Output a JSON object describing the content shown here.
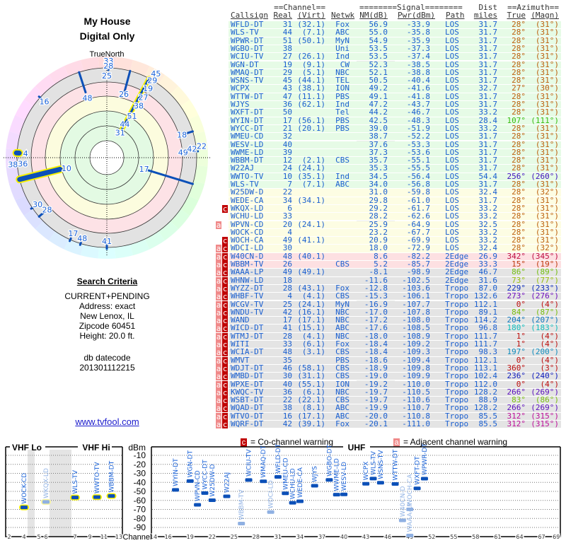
{
  "title": {
    "line1": "My House",
    "line2": "Digital Only"
  },
  "radar": {
    "north_label": "TrueNorth",
    "markers": [
      {
        "label": "33",
        "azimuth": 1
      },
      {
        "label": "28",
        "azimuth": 1
      },
      {
        "label": "25",
        "azimuth": 0
      },
      {
        "label": "48",
        "azimuth": 342
      },
      {
        "label": "26",
        "azimuth": 15
      },
      {
        "label": "45",
        "azimuth": 28
      },
      {
        "label": "29",
        "azimuth": 28
      },
      {
        "label": "19",
        "azimuth": 28
      },
      {
        "label": "27",
        "azimuth": 28
      },
      {
        "label": "38",
        "azimuth": 28
      },
      {
        "label": "51",
        "azimuth": 28
      },
      {
        "label": "44",
        "azimuth": 28
      },
      {
        "label": "31",
        "azimuth": 28
      },
      {
        "label": "16",
        "azimuth": 312
      },
      {
        "label": "18",
        "azimuth": 73
      },
      {
        "label": "49",
        "azimuth": 86
      },
      {
        "label": "42",
        "azimuth": 84
      },
      {
        "label": "22",
        "azimuth": 83
      },
      {
        "label": "4",
        "azimuth": 273
      },
      {
        "label": "38",
        "azimuth": 266
      },
      {
        "label": "36",
        "azimuth": 266
      },
      {
        "label": "10",
        "azimuth": 256
      },
      {
        "label": "17",
        "azimuth": 107
      },
      {
        "label": "30",
        "azimuth": 236
      },
      {
        "label": "28",
        "azimuth": 229
      },
      {
        "label": "17",
        "azimuth": 204
      },
      {
        "label": "48",
        "azimuth": 197
      },
      {
        "label": "41",
        "azimuth": 180
      }
    ]
  },
  "criteria": {
    "heading": "Search Criteria",
    "mode": "CURRENT+PENDING",
    "address": "Address: exact",
    "city": "New Lenox, IL",
    "zipcode": "Zipcode 60451",
    "height": "Height: 20.0 ft.",
    "db_label": "db datecode",
    "db_value": "201301112215"
  },
  "link": "www.tvfool.com",
  "table": {
    "group_headers": {
      "channel": "==Channel==",
      "signal": "========Signal========",
      "dist": "Dist",
      "azimuth": "==Azimuth=="
    },
    "columns": [
      "Callsign",
      "Real",
      "(Virt)",
      "Netwk",
      "NM(dB)",
      "Pwr(dBm)",
      "Path",
      "miles",
      "True",
      "(Magn)"
    ],
    "rows": [
      [
        "WFLD-DT",
        "31",
        "(32.1)",
        "Fox",
        "56.9",
        "-33.9",
        "LOS",
        "31.7",
        "28°",
        "(31°)",
        "",
        "g"
      ],
      [
        "WLS-TV",
        "44",
        "(7.1)",
        "ABC",
        "55.0",
        "-35.8",
        "LOS",
        "31.7",
        "28°",
        "(31°)",
        "",
        "g"
      ],
      [
        "WPWR-DT",
        "51",
        "(50.1)",
        "MyN",
        "54.9",
        "-35.9",
        "LOS",
        "31.7",
        "28°",
        "(31°)",
        "",
        "g"
      ],
      [
        "WGBO-DT",
        "38",
        "",
        "Uni",
        "53.5",
        "-37.3",
        "LOS",
        "31.7",
        "28°",
        "(31°)",
        "",
        "g"
      ],
      [
        "WCIU-TV",
        "27",
        "(26.1)",
        "Ind",
        "53.5",
        "-37.4",
        "LOS",
        "31.7",
        "28°",
        "(31°)",
        "",
        "g"
      ],
      [
        "WGN-DT",
        "19",
        "(9.1)",
        "CW",
        "52.3",
        "-38.5",
        "LOS",
        "31.7",
        "28°",
        "(31°)",
        "",
        "g"
      ],
      [
        "WMAQ-DT",
        "29",
        "(5.1)",
        "NBC",
        "52.1",
        "-38.8",
        "LOS",
        "31.7",
        "28°",
        "(31°)",
        "",
        "g"
      ],
      [
        "WSNS-TV",
        "45",
        "(44.1)",
        "TEL",
        "50.5",
        "-40.4",
        "LOS",
        "31.7",
        "28°",
        "(31°)",
        "",
        "g"
      ],
      [
        "WCPX",
        "43",
        "(38.1)",
        "ION",
        "49.2",
        "-41.6",
        "LOS",
        "32.7",
        "27°",
        "(30°)",
        "",
        "g"
      ],
      [
        "WTTW-DT",
        "47",
        "(11.1)",
        "PBS",
        "49.1",
        "-41.8",
        "LOS",
        "31.7",
        "28°",
        "(31°)",
        "",
        "g"
      ],
      [
        "WJYS",
        "36",
        "(62.1)",
        "Ind",
        "47.2",
        "-43.7",
        "LOS",
        "31.7",
        "28°",
        "(31°)",
        "",
        "g"
      ],
      [
        "WXFT-DT",
        "50",
        "",
        "Tel",
        "44.2",
        "-46.7",
        "LOS",
        "33.2",
        "28°",
        "(31°)",
        "",
        "g"
      ],
      [
        "WYIN-DT",
        "17",
        "(56.1)",
        "PBS",
        "42.5",
        "-48.3",
        "LOS",
        "28.4",
        "107°",
        "(111°)",
        "",
        "g"
      ],
      [
        "WYCC-DT",
        "21",
        "(20.1)",
        "PBS",
        "39.0",
        "-51.9",
        "LOS",
        "33.2",
        "28°",
        "(31°)",
        "",
        "g"
      ],
      [
        "WMEU-CD",
        "32",
        "",
        "",
        "38.7",
        "-52.2",
        "LOS",
        "31.7",
        "28°",
        "(31°)",
        "",
        "g"
      ],
      [
        "WESV-LD",
        "40",
        "",
        "",
        "37.6",
        "-53.3",
        "LOS",
        "31.7",
        "28°",
        "(31°)",
        "",
        "g"
      ],
      [
        "WWME-LD",
        "39",
        "",
        "",
        "37.3",
        "-53.6",
        "LOS",
        "31.7",
        "28°",
        "(31°)",
        "",
        "g"
      ],
      [
        "WBBM-DT",
        "12",
        "(2.1)",
        "CBS",
        "35.7",
        "-55.1",
        "LOS",
        "31.7",
        "28°",
        "(31°)",
        "",
        "g"
      ],
      [
        "W22AJ",
        "24",
        "(24.1)",
        "",
        "35.3",
        "-55.5",
        "LOS",
        "31.7",
        "28°",
        "(31°)",
        "",
        "g"
      ],
      [
        "WWTO-TV",
        "10",
        "(35.1)",
        "Ind",
        "34.5",
        "-56.4",
        "LOS",
        "54.4",
        "256°",
        "(260°)",
        "",
        "g"
      ],
      [
        "WLS-TV",
        "7",
        "(7.1)",
        "ABC",
        "34.0",
        "-56.8",
        "LOS",
        "31.7",
        "28°",
        "(31°)",
        "",
        "g"
      ],
      [
        "W25DW-D",
        "22",
        "",
        "",
        "31.0",
        "-59.8",
        "LOS",
        "32.4",
        "28°",
        "(32°)",
        "",
        "y"
      ],
      [
        "WEDE-CA",
        "34",
        "(34.1)",
        "",
        "29.8",
        "-61.0",
        "LOS",
        "31.7",
        "28°",
        "(31°)",
        "",
        "y"
      ],
      [
        "WKQX-LD",
        "6",
        "",
        "",
        "29.2",
        "-61.7",
        "LOS",
        "33.2",
        "28°",
        "(31°)",
        "c",
        "y"
      ],
      [
        "WCHU-LD",
        "33",
        "",
        "",
        "28.2",
        "-62.6",
        "LOS",
        "33.2",
        "28°",
        "(31°)",
        "",
        "y"
      ],
      [
        "WPVN-CD",
        "20",
        "(24.1)",
        "",
        "25.9",
        "-64.9",
        "LOS",
        "32.5",
        "28°",
        "(31°)",
        "a",
        "y"
      ],
      [
        "WOCK-CD",
        "4",
        "",
        "",
        "23.2",
        "-67.7",
        "LOS",
        "33.2",
        "28°",
        "(31°)",
        "",
        "y"
      ],
      [
        "WOCH-CA",
        "49",
        "(41.1)",
        "",
        "20.9",
        "-69.9",
        "LOS",
        "33.2",
        "28°",
        "(31°)",
        "c",
        "y"
      ],
      [
        "WDCI-LD",
        "30",
        "",
        "",
        "18.0",
        "-72.9",
        "LOS",
        "32.4",
        "28°",
        "(32°)",
        "ac",
        "y"
      ],
      [
        "W40CN-D",
        "48",
        "(40.1)",
        "",
        "8.6",
        "-82.2",
        "2Edge",
        "26.9",
        "342°",
        "(345°)",
        "ac",
        "p"
      ],
      [
        "WBBM-TV",
        "26",
        "",
        "CBS",
        "5.2",
        "-85.7",
        "2Edge",
        "33.3",
        "15°",
        "(19°)",
        "ac",
        "p"
      ],
      [
        "WAAA-LP",
        "49",
        "(49.1)",
        "",
        "-8.1",
        "-98.9",
        "2Edge",
        "46.7",
        "86°",
        "(89°)",
        "ac",
        "x"
      ],
      [
        "WHNW-LD",
        "18",
        "",
        "",
        "-11.6",
        "-102.5",
        "2Edge",
        "31.6",
        "73°",
        "(77°)",
        "ac",
        "x"
      ],
      [
        "WYZZ-DT",
        "28",
        "(43.1)",
        "Fox",
        "-12.8",
        "-103.6",
        "Tropo",
        "87.0",
        "229°",
        "(233°)",
        "ac",
        "x"
      ],
      [
        "WHBF-TV",
        "4",
        "(4.1)",
        "CBS",
        "-15.3",
        "-106.1",
        "Tropo",
        "132.6",
        "273°",
        "(276°)",
        "ac",
        "x"
      ],
      [
        "WCGV-TV",
        "25",
        "(24.1)",
        "MyN",
        "-16.9",
        "-107.7",
        "Tropo",
        "112.1",
        "0°",
        "(4°)",
        "ac",
        "x"
      ],
      [
        "WNDU-TV",
        "42",
        "(16.1)",
        "NBC",
        "-17.0",
        "-107.8",
        "Tropo",
        "89.1",
        "84°",
        "(87°)",
        "ac",
        "x"
      ],
      [
        "WAND",
        "17",
        "(17.1)",
        "NBC",
        "-17.2",
        "-108.0",
        "Tropo",
        "114.2",
        "204°",
        "(207°)",
        "ac",
        "x"
      ],
      [
        "WICD-DT",
        "41",
        "(15.1)",
        "ABC",
        "-17.6",
        "-108.5",
        "Tropo",
        "96.8",
        "180°",
        "(183°)",
        "ac",
        "x"
      ],
      [
        "WTMJ-DT",
        "28",
        "(4.1)",
        "NBC",
        "-18.0",
        "-108.9",
        "Tropo",
        "111.7",
        "1°",
        "(4°)",
        "ac",
        "x"
      ],
      [
        "WITI",
        "33",
        "(6.1)",
        "Fox",
        "-18.4",
        "-109.2",
        "Tropo",
        "111.7",
        "1°",
        "(4°)",
        "ac",
        "x"
      ],
      [
        "WCIA-DT",
        "48",
        "(3.1)",
        "CBS",
        "-18.4",
        "-109.3",
        "Tropo",
        "98.3",
        "197°",
        "(200°)",
        "ac",
        "x"
      ],
      [
        "WMVT",
        "35",
        "",
        "PBS",
        "-18.6",
        "-109.4",
        "Tropo",
        "112.1",
        "0°",
        "(4°)",
        "ac",
        "x"
      ],
      [
        "WDJT-DT",
        "46",
        "(58.1)",
        "CBS",
        "-18.9",
        "-109.8",
        "Tropo",
        "113.1",
        "360°",
        "(3°)",
        "ac",
        "x"
      ],
      [
        "WMBD-DT",
        "30",
        "(31.1)",
        "CBS",
        "-19.0",
        "-109.9",
        "Tropo",
        "102.4",
        "236°",
        "(240°)",
        "ac",
        "x"
      ],
      [
        "WPXE-DT",
        "40",
        "(55.1)",
        "ION",
        "-19.2",
        "-110.0",
        "Tropo",
        "112.0",
        "0°",
        "(4°)",
        "ac",
        "x"
      ],
      [
        "KWQC-TV",
        "36",
        "(6.1)",
        "NBC",
        "-19.7",
        "-110.5",
        "Tropo",
        "128.2",
        "266°",
        "(269°)",
        "ac",
        "x"
      ],
      [
        "WSBT-DT",
        "22",
        "(22.1)",
        "CBS",
        "-19.7",
        "-110.6",
        "Tropo",
        "88.9",
        "83°",
        "(86°)",
        "ac",
        "x"
      ],
      [
        "WQAD-DT",
        "38",
        "(8.1)",
        "ABC",
        "-19.9",
        "-110.7",
        "Tropo",
        "128.2",
        "266°",
        "(269°)",
        "ac",
        "x"
      ],
      [
        "WTVO-DT",
        "16",
        "(17.1)",
        "ABC",
        "-20.0",
        "-110.8",
        "Tropo",
        "85.5",
        "312°",
        "(315°)",
        "ac",
        "x"
      ],
      [
        "WQRF-DT",
        "42",
        "(39.1)",
        "Fox",
        "-20.1",
        "-111.0",
        "Tropo",
        "85.5",
        "312°",
        "(315°)",
        "ac",
        "x"
      ]
    ],
    "row_colors": {
      "g": "#e6fbe6",
      "y": "#fdfde3",
      "p": "#fde0e2",
      "x": "#e4e4e4"
    },
    "warn_colors": {
      "c": "#c00000",
      "a": "#f08a8a"
    }
  },
  "legend": {
    "co_symbol": "c",
    "co_label": "= Co-channel warning",
    "adj_symbol": "a",
    "adj_label": "= Adjacent channel warning"
  },
  "chart_data": {
    "type": "bar",
    "panels": [
      "VHF Lo",
      "VHF Hi",
      "UHF"
    ],
    "ylabel": "dBm",
    "xlabel": "Channel",
    "ylim": [
      -95,
      -5
    ],
    "yticks": [
      "-10",
      "-20",
      "-30",
      "-40",
      "-50",
      "-60",
      "-70",
      "-80",
      "-90"
    ],
    "vhf_ticks": [
      "2",
      "4",
      "5",
      "6",
      "7",
      "9",
      "11",
      "13"
    ],
    "uhf_ticks": [
      "14",
      "16",
      "19",
      "22",
      "25",
      "28",
      "31",
      "34",
      "37",
      "40",
      "43",
      "46",
      "49",
      "52",
      "55",
      "58",
      "61",
      "64",
      "67",
      "69"
    ],
    "grid": true,
    "stations": [
      {
        "name": "WOCK-CD",
        "channel": 4,
        "dbm": -67.7,
        "highlight": true
      },
      {
        "name": "WKQX-LD",
        "channel": 6,
        "dbm": -61.7,
        "highlight": true,
        "faded": true
      },
      {
        "name": "WLS-TV",
        "channel": 7,
        "dbm": -56.8,
        "highlight": true
      },
      {
        "name": "WWTO-TV",
        "channel": 10,
        "dbm": -56.4,
        "highlight": true
      },
      {
        "name": "WBBM-DT",
        "channel": 12,
        "dbm": -55.1,
        "highlight": true
      },
      {
        "name": "WYIN-DT",
        "channel": 17,
        "dbm": -48.3
      },
      {
        "name": "WGN-DT",
        "channel": 19,
        "dbm": -38.5
      },
      {
        "name": "WPVN-CD",
        "channel": 20,
        "dbm": -64.9
      },
      {
        "name": "WYCC-DT",
        "channel": 21,
        "dbm": -51.9
      },
      {
        "name": "W25DW-D",
        "channel": 22,
        "dbm": -59.8
      },
      {
        "name": "W22AJ",
        "channel": 24,
        "dbm": -55.5
      },
      {
        "name": "WBBM-TV",
        "channel": 26,
        "dbm": -85.7,
        "faded": true
      },
      {
        "name": "WCIU-TV",
        "channel": 27,
        "dbm": -37.4
      },
      {
        "name": "WMAQ-DT",
        "channel": 29,
        "dbm": -38.8
      },
      {
        "name": "WDCI-LD",
        "channel": 30,
        "dbm": -72.9,
        "faded": true
      },
      {
        "name": "WFLD-DT",
        "channel": 31,
        "dbm": -33.9
      },
      {
        "name": "WMEU-CD",
        "channel": 32,
        "dbm": -52.2
      },
      {
        "name": "WCHU-LD",
        "channel": 33,
        "dbm": -62.6
      },
      {
        "name": "WEDE-CA",
        "channel": 34,
        "dbm": -61.0
      },
      {
        "name": "WJYS",
        "channel": 36,
        "dbm": -43.7
      },
      {
        "name": "WGBO-DT",
        "channel": 38,
        "dbm": -37.3
      },
      {
        "name": "WWME-LD",
        "channel": 39,
        "dbm": -53.6
      },
      {
        "name": "WESV-LD",
        "channel": 40,
        "dbm": -53.3
      },
      {
        "name": "WCPX",
        "channel": 43,
        "dbm": -41.6
      },
      {
        "name": "WLS-TV",
        "channel": 44,
        "dbm": -35.8
      },
      {
        "name": "WSNS-TV",
        "channel": 45,
        "dbm": -40.4
      },
      {
        "name": "WTTW-DT",
        "channel": 47,
        "dbm": -41.8
      },
      {
        "name": "W40CN-D",
        "channel": 48,
        "dbm": -82.2,
        "faded": true
      },
      {
        "name": "WAAA-LP",
        "channel": 49,
        "dbm": -98.9,
        "faded": true
      },
      {
        "name": "WOCH-CA",
        "channel": 49,
        "dbm": -69.9,
        "faded": true
      },
      {
        "name": "WXFT-DT",
        "channel": 50,
        "dbm": -46.7
      },
      {
        "name": "WPWR-DT",
        "channel": 51,
        "dbm": -35.9
      }
    ]
  }
}
